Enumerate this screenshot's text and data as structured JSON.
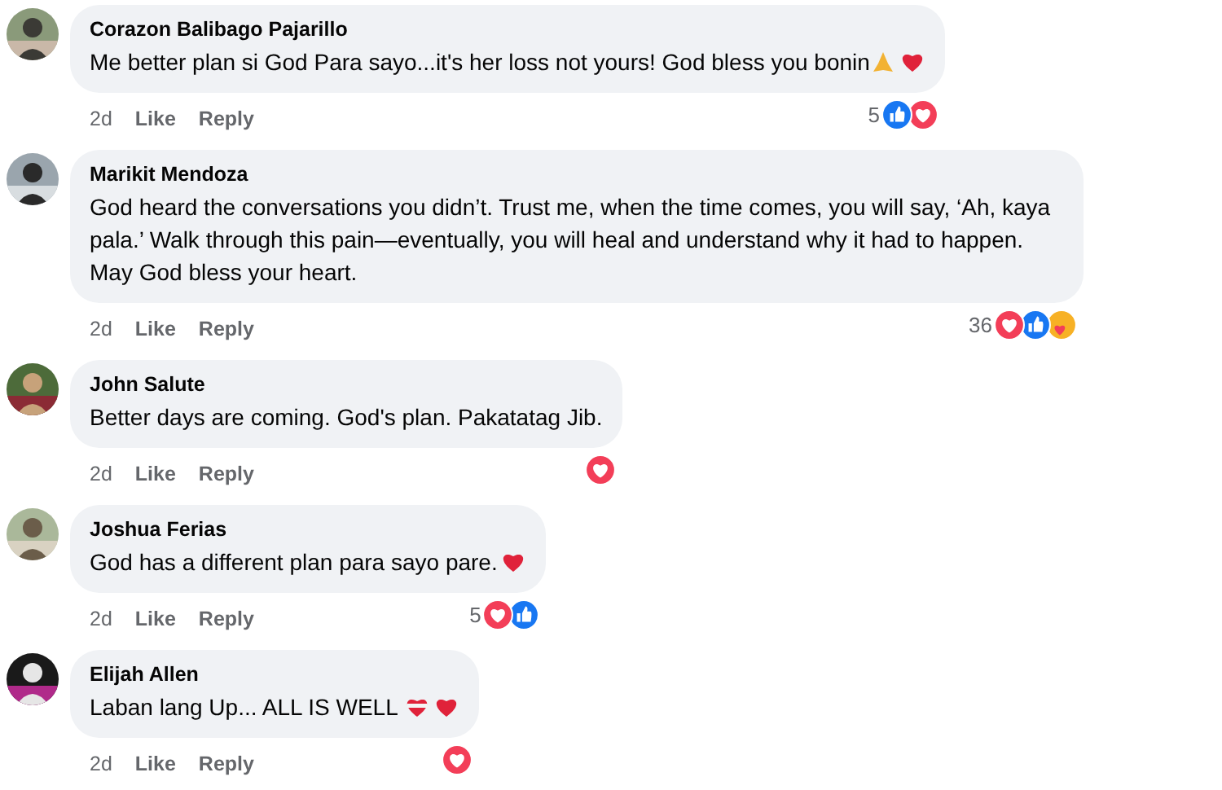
{
  "comments": [
    {
      "author": "Corazon Balibago Pajarillo",
      "text": "Me better plan si God Para sayo...it's her loss not yours! God bless you bonin",
      "emojis": [
        {
          "kind": "pray"
        },
        {
          "kind": "heart"
        }
      ],
      "time": "2d",
      "like": "Like",
      "reply": "Reply",
      "reaction_count": "5",
      "reactions": [
        {
          "kind": "like"
        },
        {
          "kind": "love"
        }
      ],
      "avatar": {
        "kind": "picture"
      }
    },
    {
      "author": "Marikit Mendoza",
      "text": "God heard the conversations you didn’t. Trust me, when the time comes, you will say, ‘Ah, kaya pala.’ Walk through this pain—eventually, you will heal and understand why it had to happen. May God bless your heart.",
      "time": "2d",
      "like": "Like",
      "reply": "Reply",
      "reaction_count": "36",
      "reactions": [
        {
          "kind": "love"
        },
        {
          "kind": "like"
        },
        {
          "kind": "care"
        }
      ],
      "avatar": {
        "kind": "picture"
      }
    },
    {
      "author": "John Salute",
      "text": "Better days are coming. God's plan. Pakatatag Jib.",
      "time": "2d",
      "like": "Like",
      "reply": "Reply",
      "reactions": [
        {
          "kind": "love"
        }
      ],
      "avatar": {
        "kind": "picture"
      }
    },
    {
      "author": "Joshua Ferias",
      "text": "God has a different plan para sayo pare.",
      "emojis": [
        {
          "kind": "heart"
        }
      ],
      "time": "2d",
      "like": "Like",
      "reply": "Reply",
      "reaction_count": "5",
      "reactions": [
        {
          "kind": "love"
        },
        {
          "kind": "like"
        }
      ],
      "avatar": {
        "kind": "picture"
      }
    },
    {
      "author": "Elijah Allen",
      "text": "Laban lang Up... ALL IS WELL",
      "emojis": [
        {
          "kind": "mended-heart"
        },
        {
          "kind": "heart"
        }
      ],
      "time": "2d",
      "like": "Like",
      "reply": "Reply",
      "reactions": [
        {
          "kind": "love"
        }
      ],
      "avatar": {
        "kind": "picture"
      }
    }
  ]
}
